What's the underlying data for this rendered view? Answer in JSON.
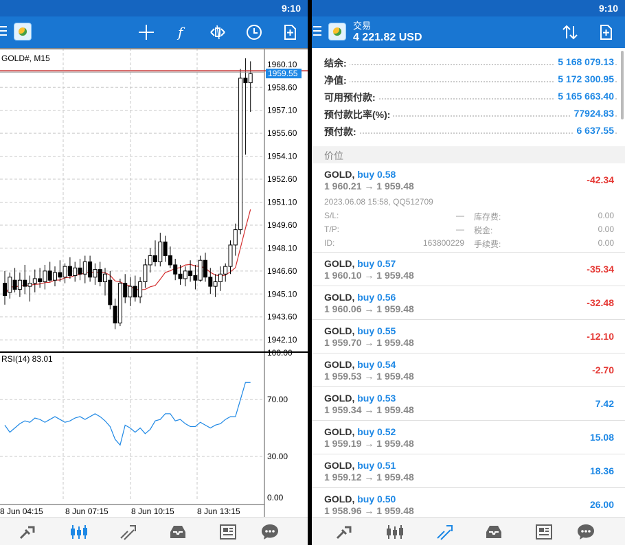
{
  "status": {
    "time": "9:10"
  },
  "chart": {
    "symbol_label": "GOLD#, M15",
    "current_price": "1959.55",
    "price_ticks": [
      "1960.10",
      "1958.60",
      "1957.10",
      "1955.60",
      "1954.10",
      "1952.60",
      "1951.10",
      "1949.60",
      "1948.10",
      "1946.60",
      "1945.10",
      "1943.60",
      "1942.10"
    ],
    "rsi_label": "RSI(14) 83.01",
    "rsi_ticks": [
      "100.00",
      "70.00",
      "30.00",
      "0.00"
    ],
    "time_ticks": [
      "8 Jun 04:15",
      "8 Jun 07:15",
      "8 Jun 10:15",
      "8 Jun 13:15"
    ],
    "colors": {
      "bid_line": "#c62828",
      "ma_line": "#d32f2f",
      "rsi_line": "#1e88e5",
      "price_box": "#1e88e5"
    }
  },
  "chart_data": {
    "type": "candlestick",
    "symbol": "GOLD#",
    "timeframe": "M15",
    "ylim": [
      1941.3,
      1960.9
    ],
    "candles": [
      {
        "o": 1945.8,
        "h": 1946.6,
        "l": 1944.4,
        "c": 1945.0
      },
      {
        "o": 1945.2,
        "h": 1946.5,
        "l": 1944.8,
        "c": 1946.2
      },
      {
        "o": 1946.0,
        "h": 1946.8,
        "l": 1945.2,
        "c": 1945.4
      },
      {
        "o": 1945.4,
        "h": 1946.5,
        "l": 1944.9,
        "c": 1946.0
      },
      {
        "o": 1946.0,
        "h": 1947.0,
        "l": 1945.1,
        "c": 1945.6
      },
      {
        "o": 1945.6,
        "h": 1946.3,
        "l": 1944.6,
        "c": 1945.8
      },
      {
        "o": 1945.8,
        "h": 1946.7,
        "l": 1945.2,
        "c": 1946.1
      },
      {
        "o": 1946.1,
        "h": 1946.8,
        "l": 1945.5,
        "c": 1945.9
      },
      {
        "o": 1945.9,
        "h": 1947.0,
        "l": 1945.4,
        "c": 1946.6
      },
      {
        "o": 1946.6,
        "h": 1947.2,
        "l": 1945.9,
        "c": 1946.0
      },
      {
        "o": 1946.0,
        "h": 1946.9,
        "l": 1945.6,
        "c": 1946.5
      },
      {
        "o": 1946.5,
        "h": 1947.3,
        "l": 1945.9,
        "c": 1946.2
      },
      {
        "o": 1946.2,
        "h": 1947.1,
        "l": 1945.8,
        "c": 1946.9
      },
      {
        "o": 1946.9,
        "h": 1947.5,
        "l": 1946.1,
        "c": 1946.3
      },
      {
        "o": 1946.3,
        "h": 1947.2,
        "l": 1945.9,
        "c": 1946.8
      },
      {
        "o": 1946.8,
        "h": 1947.4,
        "l": 1946.0,
        "c": 1946.4
      },
      {
        "o": 1946.4,
        "h": 1947.6,
        "l": 1945.8,
        "c": 1947.2
      },
      {
        "o": 1947.2,
        "h": 1947.6,
        "l": 1945.9,
        "c": 1946.2
      },
      {
        "o": 1946.2,
        "h": 1947.1,
        "l": 1945.7,
        "c": 1946.7
      },
      {
        "o": 1946.7,
        "h": 1947.2,
        "l": 1945.6,
        "c": 1945.9
      },
      {
        "o": 1945.9,
        "h": 1946.8,
        "l": 1945.0,
        "c": 1946.4
      },
      {
        "o": 1946.0,
        "h": 1946.6,
        "l": 1944.1,
        "c": 1944.4
      },
      {
        "o": 1944.3,
        "h": 1944.8,
        "l": 1942.8,
        "c": 1943.2
      },
      {
        "o": 1943.2,
        "h": 1946.1,
        "l": 1943.0,
        "c": 1945.8
      },
      {
        "o": 1945.8,
        "h": 1946.4,
        "l": 1944.5,
        "c": 1944.9
      },
      {
        "o": 1944.9,
        "h": 1946.2,
        "l": 1944.3,
        "c": 1945.6
      },
      {
        "o": 1945.6,
        "h": 1946.3,
        "l": 1944.6,
        "c": 1944.9
      },
      {
        "o": 1944.9,
        "h": 1946.2,
        "l": 1944.5,
        "c": 1945.9
      },
      {
        "o": 1945.9,
        "h": 1947.4,
        "l": 1945.5,
        "c": 1947.0
      },
      {
        "o": 1947.0,
        "h": 1948.1,
        "l": 1946.5,
        "c": 1947.6
      },
      {
        "o": 1947.6,
        "h": 1948.6,
        "l": 1946.9,
        "c": 1947.2
      },
      {
        "o": 1947.2,
        "h": 1949.1,
        "l": 1946.9,
        "c": 1948.5
      },
      {
        "o": 1948.5,
        "h": 1948.9,
        "l": 1947.2,
        "c": 1947.6
      },
      {
        "o": 1947.6,
        "h": 1948.2,
        "l": 1946.8,
        "c": 1947.0
      },
      {
        "o": 1947.0,
        "h": 1947.4,
        "l": 1946.0,
        "c": 1946.4
      },
      {
        "o": 1946.4,
        "h": 1947.0,
        "l": 1945.7,
        "c": 1946.1
      },
      {
        "o": 1946.1,
        "h": 1946.9,
        "l": 1945.6,
        "c": 1946.6
      },
      {
        "o": 1946.6,
        "h": 1947.3,
        "l": 1945.9,
        "c": 1946.3
      },
      {
        "o": 1946.3,
        "h": 1947.0,
        "l": 1945.4,
        "c": 1946.0
      },
      {
        "o": 1946.0,
        "h": 1947.6,
        "l": 1945.9,
        "c": 1947.3
      },
      {
        "o": 1947.3,
        "h": 1947.8,
        "l": 1945.9,
        "c": 1946.2
      },
      {
        "o": 1946.2,
        "h": 1946.8,
        "l": 1945.1,
        "c": 1945.6
      },
      {
        "o": 1945.6,
        "h": 1946.4,
        "l": 1944.9,
        "c": 1945.9
      },
      {
        "o": 1945.9,
        "h": 1946.9,
        "l": 1945.3,
        "c": 1946.4
      },
      {
        "o": 1946.4,
        "h": 1947.1,
        "l": 1945.9,
        "c": 1946.9
      },
      {
        "o": 1946.9,
        "h": 1948.6,
        "l": 1946.4,
        "c": 1948.3
      },
      {
        "o": 1948.3,
        "h": 1949.7,
        "l": 1947.6,
        "c": 1949.3
      },
      {
        "o": 1949.3,
        "h": 1959.8,
        "l": 1949.0,
        "c": 1959.2
      },
      {
        "o": 1959.2,
        "h": 1960.5,
        "l": 1954.2,
        "c": 1958.9
      },
      {
        "o": 1958.9,
        "h": 1960.3,
        "l": 1957.0,
        "c": 1959.5
      }
    ],
    "rsi": [
      52,
      47,
      50,
      53,
      55,
      54,
      57,
      56,
      54,
      56,
      58,
      56,
      54,
      55,
      57,
      58,
      56,
      58,
      60,
      58,
      55,
      51,
      42,
      38,
      52,
      50,
      47,
      50,
      46,
      49,
      55,
      56,
      60,
      60,
      55,
      56,
      53,
      51,
      51,
      54,
      52,
      50,
      52,
      53,
      56,
      58,
      58,
      70,
      82,
      82
    ],
    "rsi_ylim": [
      0,
      100
    ]
  },
  "account": {
    "title": "交易",
    "balance_header": "4 221.82 USD",
    "summary": [
      {
        "label": "结余:",
        "value": "5 168 079.13"
      },
      {
        "label": "净值:",
        "value": "5 172 300.95"
      },
      {
        "label": "可用预付款:",
        "value": "5 165 663.40"
      },
      {
        "label": "预付款比率(%):",
        "value": "77924.83"
      },
      {
        "label": "预付款:",
        "value": "6 637.55"
      }
    ],
    "section_title": "价位"
  },
  "positions": [
    {
      "symbol": "GOLD,",
      "side": "buy 0.58",
      "prices": "1 960.21 → 1 959.48",
      "pl": "-42.34",
      "negative": true,
      "details": {
        "time": "2023.06.08 15:58, QQ512709",
        "sl_label": "S/L:",
        "sl": "—",
        "tp_label": "T/P:",
        "tp": "—",
        "id_label": "ID:",
        "id": "163800229",
        "swap_label": "库存费:",
        "swap": "0.00",
        "tax_label": "税金:",
        "tax": "0.00",
        "fee_label": "手续费:",
        "fee": "0.00"
      }
    },
    {
      "symbol": "GOLD,",
      "side": "buy 0.57",
      "prices": "1 960.10 → 1 959.48",
      "pl": "-35.34",
      "negative": true
    },
    {
      "symbol": "GOLD,",
      "side": "buy 0.56",
      "prices": "1 960.06 → 1 959.48",
      "pl": "-32.48",
      "negative": true
    },
    {
      "symbol": "GOLD,",
      "side": "buy 0.55",
      "prices": "1 959.70 → 1 959.48",
      "pl": "-12.10",
      "negative": true
    },
    {
      "symbol": "GOLD,",
      "side": "buy 0.54",
      "prices": "1 959.53 → 1 959.48",
      "pl": "-2.70",
      "negative": true
    },
    {
      "symbol": "GOLD,",
      "side": "buy 0.53",
      "prices": "1 959.34 → 1 959.48",
      "pl": "7.42",
      "negative": false
    },
    {
      "symbol": "GOLD,",
      "side": "buy 0.52",
      "prices": "1 959.19 → 1 959.48",
      "pl": "15.08",
      "negative": false
    },
    {
      "symbol": "GOLD,",
      "side": "buy 0.51",
      "prices": "1 959.12 → 1 959.48",
      "pl": "18.36",
      "negative": false
    },
    {
      "symbol": "GOLD,",
      "side": "buy 0.50",
      "prices": "1 958.96 → 1 959.48",
      "pl": "26.00",
      "negative": false
    }
  ],
  "icons": {
    "toolbar_left": [
      "crosshair-icon",
      "function-icon",
      "shapes-icon",
      "timeframe-clock-icon",
      "new-order-icon"
    ],
    "toolbar_right": [
      "sort-icon",
      "new-order-icon"
    ],
    "nav": [
      "quotes-icon",
      "chart-icon",
      "trade-icon",
      "history-icon",
      "news-icon",
      "chat-icon"
    ]
  },
  "theme": {
    "primary": "#1976d2",
    "status": "#1565c0",
    "active_nav": "#1e88e5",
    "inactive_nav": "#616161"
  }
}
